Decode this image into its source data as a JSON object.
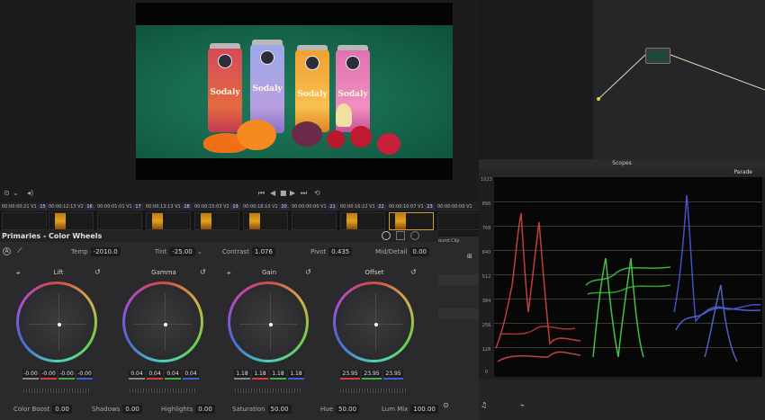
{
  "timeline": {
    "clips": [
      {
        "timecode": "00:00:00:21",
        "track": "V1",
        "num": "15"
      },
      {
        "timecode": "00:00:12:13",
        "track": "V2",
        "num": "16"
      },
      {
        "timecode": "00:00:01:01",
        "track": "V1",
        "num": "17"
      },
      {
        "timecode": "00:00:13:13",
        "track": "V1",
        "num": "18"
      },
      {
        "timecode": "00:00:15:03",
        "track": "V2",
        "num": "19"
      },
      {
        "timecode": "00:00:18:10",
        "track": "V1",
        "num": "20"
      },
      {
        "timecode": "00:00:00:00",
        "track": "V1",
        "num": "21"
      },
      {
        "timecode": "00:00:16:22",
        "track": "V1",
        "num": "22"
      },
      {
        "timecode": "00:00:10:07",
        "track": "V1",
        "num": "23"
      },
      {
        "timecode": "00:00:00:00",
        "track": "V1",
        "num": ""
      }
    ]
  },
  "viewer": {
    "brand": "Sodaly"
  },
  "panel": {
    "title": "Primaries - Color Wheels",
    "temp_label": "Temp",
    "temp_value": "-2010.0",
    "tint_label": "Tint",
    "tint_value": "-25.00",
    "contrast_label": "Contrast",
    "contrast_value": "1.076",
    "pivot_label": "Pivot",
    "pivot_value": "0.435",
    "middetail_label": "Mid/Detail",
    "middetail_value": "0.00",
    "colorboost_label": "Color Boost",
    "colorboost_value": "0.00",
    "shadows_label": "Shadows",
    "shadows_value": "0.00",
    "highlights_label": "Highlights",
    "highlights_value": "0.00",
    "saturation_label": "Saturation",
    "saturation_value": "50.00",
    "hue_label": "Hue",
    "hue_value": "50.00",
    "lummix_label": "Lum Mix",
    "lummix_value": "100.00"
  },
  "wheels": {
    "lift": {
      "label": "Lift",
      "values": [
        "-0.00",
        "-0.00",
        "-0.00",
        "-0.00"
      ]
    },
    "gamma": {
      "label": "Gamma",
      "values": [
        "0.04",
        "0.04",
        "0.04",
        "0.04"
      ]
    },
    "gain": {
      "label": "Gain",
      "values": [
        "1.18",
        "1.18",
        "1.18",
        "1.18"
      ]
    },
    "offset": {
      "label": "Offset",
      "values": [
        "23.95",
        "23.95",
        "23.95"
      ]
    }
  },
  "side_panel": {
    "tab_label": "ound Clip"
  },
  "scopes": {
    "title": "Scopes",
    "mode": "Parade",
    "ticks": [
      "1023",
      "896",
      "768",
      "640",
      "512",
      "384",
      "256",
      "128",
      "0"
    ]
  },
  "colors": {
    "accent": "#d1b14a",
    "red_channel": "#d04040",
    "green_channel": "#40b040",
    "blue_channel": "#4060d0"
  }
}
